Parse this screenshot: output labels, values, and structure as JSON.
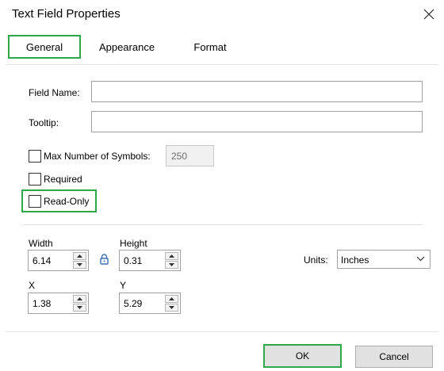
{
  "dialog": {
    "title": "Text Field Properties"
  },
  "tabs": [
    {
      "label": "General",
      "active": true
    },
    {
      "label": "Appearance",
      "active": false
    },
    {
      "label": "Format",
      "active": false
    }
  ],
  "general": {
    "field_name_label": "Field Name:",
    "field_name_value": "",
    "tooltip_label": "Tooltip:",
    "tooltip_value": "",
    "max_symbols_label": "Max Number of Symbols:",
    "max_symbols_value": "250",
    "max_symbols_checked": false,
    "required_label": "Required",
    "required_checked": false,
    "readonly_label": "Read-Only",
    "readonly_checked": false
  },
  "position": {
    "width_label": "Width",
    "width_value": "6.14",
    "height_label": "Height",
    "height_value": "0.31",
    "x_label": "X",
    "x_value": "1.38",
    "y_label": "Y",
    "y_value": "5.29",
    "units_label": "Units:",
    "units_value": "Inches"
  },
  "buttons": {
    "ok": "OK",
    "cancel": "Cancel"
  },
  "colors": {
    "highlight": "#2ea84a",
    "button_bg": "#e1e1e1"
  },
  "icons": [
    "close-icon",
    "lock-icon",
    "spin-up-icon",
    "spin-down-icon",
    "chevron-down-icon"
  ]
}
